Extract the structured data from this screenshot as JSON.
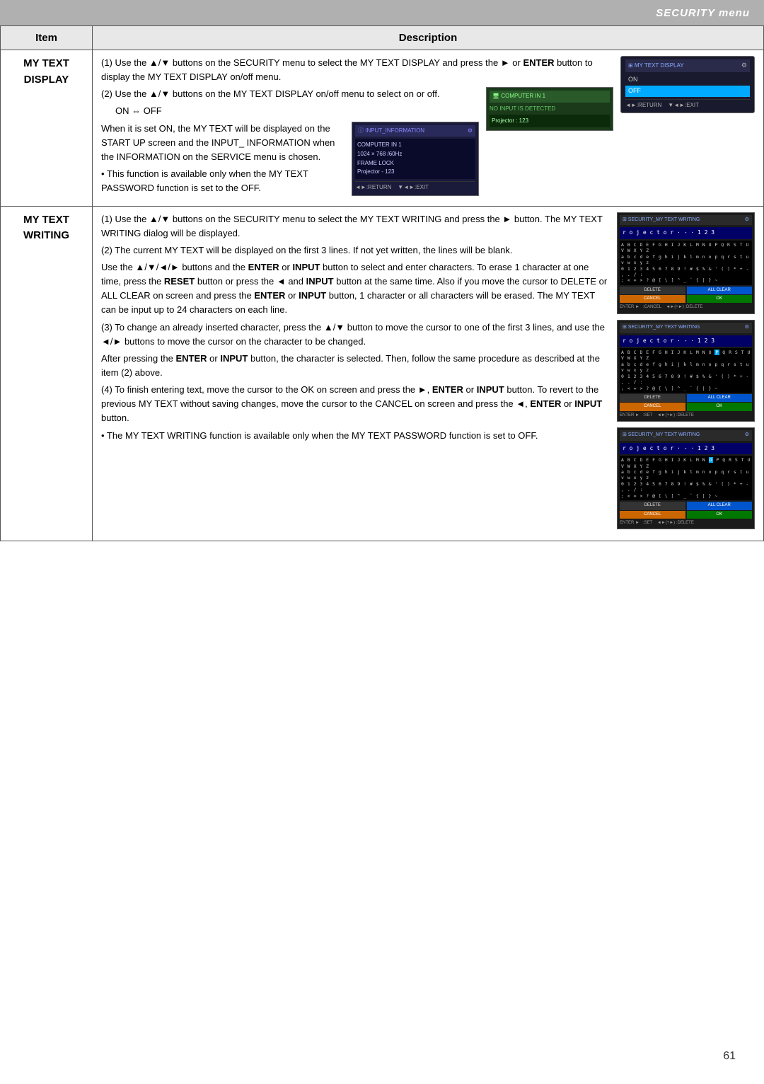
{
  "header": {
    "title": "SECURITY menu"
  },
  "table": {
    "col1_header": "Item",
    "col2_header": "Description",
    "rows": [
      {
        "item": "MY TEXT\nDISPLAY",
        "description_key": "my_text_display"
      },
      {
        "item": "MY TEXT\nWRITING",
        "description_key": "my_text_writing"
      }
    ]
  },
  "my_text_display": {
    "step1": "(1) Use the ▲/▼ buttons on the SECURITY menu to select the MY TEXT DISPLAY and press the ► or ENTER button to display the MY TEXT DISPLAY on/off menu.",
    "step2": "(2) Use the ▲/▼ buttons on the MY TEXT DISPLAY on/off menu to select on or off.",
    "step2b": "ON ⇔ OFF",
    "body1": "When it is set ON, the MY TEXT will be displayed on the START UP screen and the INPUT_ INFORMATION when the INFORMATION on the SERVICE menu is chosen.",
    "note": "• This function is available only when the MY TEXT PASSWORD function is set to the OFF.",
    "ss1_title": "MY TEXT DISPLAY",
    "ss1_on": "ON",
    "ss1_off": "OFF",
    "ss1_footer": "◄►:RETURN    ▼◄►:EXIT",
    "ss2_title": "COMPUTER IN 1",
    "ss2_sub": "NO INPUT IS DETECTED",
    "ss2_body": "Projector : 123",
    "ss3_title": "INPUT_INFORMATION",
    "ss3_icon": "i",
    "ss3_line1": "COMPUTER IN 1",
    "ss3_line2": "1024 × 768 /60Hz",
    "ss3_line3": "FRAME LOCK",
    "ss3_line4": "Projector - 123",
    "ss3_footer": "◄►:RETURN    ▼◄►:EXIT"
  },
  "my_text_writing": {
    "step1": "(1) Use the ▲/▼ buttons on the SECURITY menu to select the MY TEXT WRITING and press the ► button. The MY TEXT WRITING dialog will be displayed.",
    "step2": "(2) The current MY TEXT will be displayed on the first 3 lines. If not yet written, the lines will be blank.",
    "step2b": "Use the ▲/▼/◄/► buttons and the ENTER or INPUT button to select and enter characters. To erase 1 character at one time, press the RESET button or press the ◄ and INPUT button at the same time. Also if you move the cursor to DELETE or ALL CLEAR on screen and press the ENTER or INPUT button, 1 character or all characters will be erased. The MY TEXT can be input up to 24 characters on each line.",
    "step3": "(3) To change an already inserted character, press the ▲/▼ button to move the cursor to one of the first 3 lines, and use the ◄/► buttons to move the cursor on the character to be changed.",
    "step3b": "After pressing the ENTER or INPUT button, the character is selected. Then, follow the same procedure as described at the item (2) above.",
    "step4": "(4) To finish entering text, move the cursor to the OK on screen and press the ►, ENTER or INPUT button. To revert to the previous MY TEXT without saving changes, move the cursor to the CANCEL on screen and press the ◄, ENTER or INPUT button.",
    "note": "• The MY TEXT WRITING function is available only when the MY TEXT PASSWORD function is set to OFF.",
    "ss_title": "SECURITY_MY TEXT WRITING",
    "ss_text": "r o j e c t o r · - · 1 2 3",
    "char_rows": [
      "ABCDEFGHIJKLMNOPQRSTUVWXYZ",
      "abcdefghijklmnopqrstuvwxyz",
      "0123456789!#$%&'()*+-,./:",
      ";<=>?@[\\]^_`{|}~"
    ],
    "btn_delete": "DELETE",
    "btn_all_clear": "ALL CLEAR",
    "btn_cancel": "CANCEL",
    "btn_ok": "OK",
    "footer1": "ENTER ► :SET",
    "footer2": "RESET  ◄►(+►) :DELETE"
  },
  "page_number": "61"
}
